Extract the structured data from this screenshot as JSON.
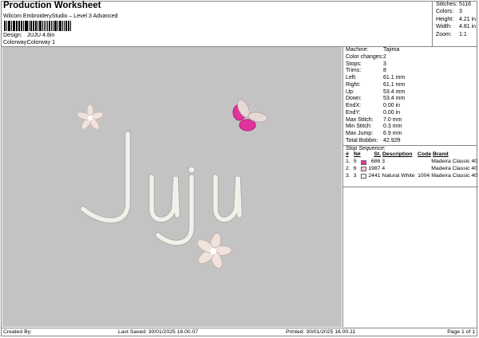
{
  "header": {
    "title": "Production Worksheet",
    "subtitle": "Wilcom EmbroideryStudio – Level 3 Advanced",
    "design_label": "Design:",
    "design_value": "JUJU 4.8in",
    "colorway_label": "Colorway:",
    "colorway_value": "Colorway 1"
  },
  "stats": [
    {
      "k": "Stitches:",
      "v": "5116"
    },
    {
      "k": "Colors:",
      "v": "3"
    },
    {
      "k": "Height:",
      "v": "4.21 in"
    },
    {
      "k": "Width:",
      "v": "4.81 in"
    },
    {
      "k": "Zoom:",
      "v": "1:1"
    }
  ],
  "details": [
    {
      "k": "Machine:",
      "v": "Tajima"
    },
    {
      "k": "Color changes:",
      "v": "2"
    },
    {
      "k": "Stops:",
      "v": "3"
    },
    {
      "k": "Trims:",
      "v": "8"
    },
    {
      "k": "Left:",
      "v": "61.1 mm"
    },
    {
      "k": "Right:",
      "v": "61.1 mm"
    },
    {
      "k": "Up:",
      "v": "53.4 mm"
    },
    {
      "k": "Down:",
      "v": "53.4 mm"
    },
    {
      "k": "EndX:",
      "v": "0.00 in"
    },
    {
      "k": "EndY:",
      "v": "0.00 in"
    },
    {
      "k": "Max Stitch:",
      "v": "7.0 mm"
    },
    {
      "k": "Min Stitch:",
      "v": "0.3 mm"
    },
    {
      "k": "Max Jump:",
      "v": "6.9 mm"
    },
    {
      "k": "Total Bobbin:",
      "v": "42.92ft"
    }
  ],
  "stop_sequence": {
    "title": "Stop Sequence:",
    "headers": [
      "#",
      "N#",
      "St.",
      "Description",
      "Code",
      "Brand"
    ],
    "rows": [
      {
        "num": "1.",
        "n": "5",
        "color": "#e0349c",
        "st": "686",
        "desc": "3",
        "code": "",
        "brand": "Madeira Classic 40"
      },
      {
        "num": "2.",
        "n": "6",
        "color": "#f4c8d4",
        "st": "1987",
        "desc": "4",
        "code": "",
        "brand": "Madeira Classic 40"
      },
      {
        "num": "3.",
        "n": "3",
        "color": "#eeeeea",
        "st": "2441",
        "desc": "Natural White",
        "code": "1004",
        "brand": "Madeira Classic 40"
      }
    ]
  },
  "footer": {
    "created_by": "Created By:",
    "last_saved": "Last Saved: 30/01/2025 16.00.07",
    "printed": "Printed: 30/01/2025 16.00.11",
    "page": "Page 1 of 1"
  },
  "design_preview": {
    "colors": {
      "background": "#c3c3c3",
      "lettering": "#eef2ea",
      "pink": "#e0349c",
      "flower": "#f2e2dc"
    }
  }
}
